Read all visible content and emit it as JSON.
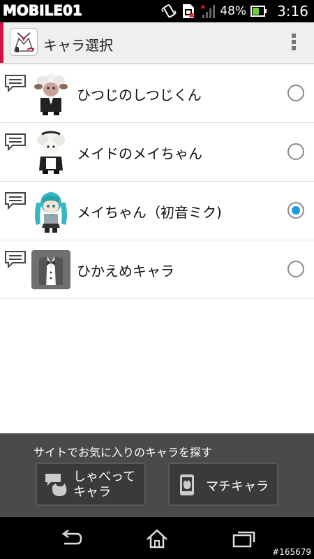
{
  "status_bar": {
    "watermark": "MOBILE01",
    "battery_percent": "48%",
    "time": "3:16",
    "icons": [
      "vibrate-icon",
      "sim-error-icon",
      "signal-icon",
      "battery-icon"
    ]
  },
  "action_bar": {
    "title": "キャラ選択",
    "accent_color": "#d31245",
    "icons": [
      "app-icon",
      "overflow-menu-icon"
    ]
  },
  "characters": [
    {
      "name": "ひつじのしつじくん",
      "selected": false,
      "avatar": "sheep-butler-avatar"
    },
    {
      "name": "メイドのメイちゃん",
      "selected": false,
      "avatar": "sheep-maid-avatar"
    },
    {
      "name": "メイちゃん（初音ミク)",
      "selected": true,
      "avatar": "miku-avatar"
    },
    {
      "name": "ひかえめキャラ",
      "selected": false,
      "avatar": "tuxedo-avatar"
    }
  ],
  "bottom_panel": {
    "title": "サイトでお気に入りのキャラを探す",
    "talk_button_line1": "しゃべって",
    "talk_button_line2": "キャラ",
    "machi_button": "マチキャラ"
  },
  "nav_bar": {
    "keys": [
      "back-icon",
      "home-icon",
      "recent-apps-icon"
    ],
    "image_id": "#165679"
  },
  "colors": {
    "selected_radio": "#1c9be0",
    "panel_bg": "#4a4a4a"
  }
}
